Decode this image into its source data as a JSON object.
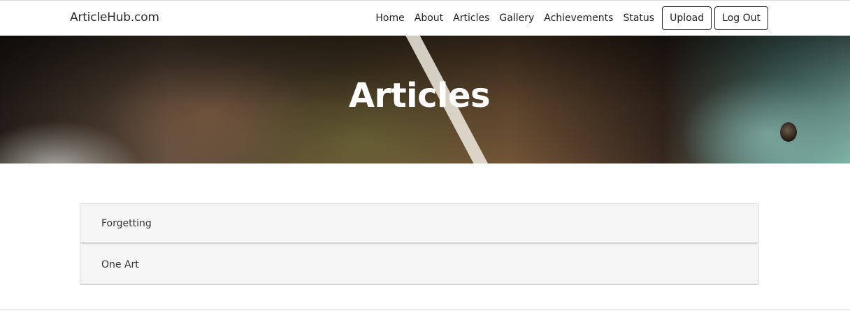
{
  "navbar": {
    "brand": "ArticleHub.com",
    "links": [
      {
        "label": "Home"
      },
      {
        "label": "About"
      },
      {
        "label": "Articles"
      },
      {
        "label": "Gallery"
      },
      {
        "label": "Achievements"
      },
      {
        "label": "Status"
      }
    ],
    "buttons": {
      "upload": "Upload",
      "logout": "Log Out"
    }
  },
  "hero": {
    "title": "Articles"
  },
  "articles": [
    {
      "title": "Forgetting"
    },
    {
      "title": "One Art"
    }
  ]
}
